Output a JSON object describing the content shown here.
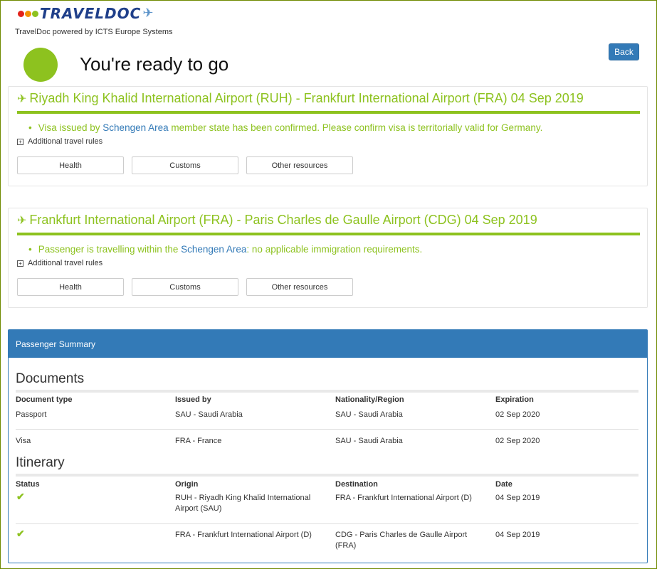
{
  "header": {
    "logo_text": "TRAVELDOC",
    "logo_dot_colors": [
      "#e2231a",
      "#f39200",
      "#8dc21f"
    ],
    "tagline": "TravelDoc powered by ICTS Europe Systems"
  },
  "back_label": "Back",
  "ready_title": "You're ready to go",
  "colors": {
    "accent": "#8dc21f",
    "primary": "#337ab7"
  },
  "legs": [
    {
      "title": "Riyadh King Khalid International Airport (RUH) - Frankfurt International Airport (FRA) 04 Sep 2019",
      "msg_before": "Visa issued by ",
      "msg_link": "Schengen Area",
      "msg_after": " member state has been confirmed. Please confirm visa is territorially valid for Germany.",
      "rules_label": "Additional travel rules",
      "buttons": [
        "Health",
        "Customs",
        "Other resources"
      ]
    },
    {
      "title": "Frankfurt International Airport (FRA) - Paris Charles de Gaulle Airport (CDG) 04 Sep 2019",
      "msg_before": "Passenger is travelling within the ",
      "msg_link": "Schengen Area",
      "msg_after": ": no applicable immigration requirements.",
      "rules_label": "Additional travel rules",
      "buttons": [
        "Health",
        "Customs",
        "Other resources"
      ]
    }
  ],
  "summary": {
    "title": "Passenger Summary",
    "documents": {
      "title": "Documents",
      "headers": [
        "Document type",
        "Issued by",
        "Nationality/Region",
        "Expiration"
      ],
      "rows": [
        [
          "Passport",
          "SAU - Saudi Arabia",
          "SAU - Saudi Arabia",
          "02 Sep 2020"
        ],
        [
          "Visa",
          "FRA - France",
          "SAU - Saudi Arabia",
          "02 Sep 2020"
        ]
      ]
    },
    "itinerary": {
      "title": "Itinerary",
      "headers": [
        "Status",
        "Origin",
        "Destination",
        "Date"
      ],
      "rows": [
        {
          "status_icon": "check-icon",
          "origin": "RUH - Riyadh King Khalid International Airport (SAU)",
          "destination": "FRA - Frankfurt International Airport (D)",
          "date": "04 Sep 2019"
        },
        {
          "status_icon": "check-icon",
          "origin": "FRA - Frankfurt International Airport (D)",
          "destination": "CDG - Paris Charles de Gaulle Airport (FRA)",
          "date": "04 Sep 2019"
        }
      ]
    }
  }
}
